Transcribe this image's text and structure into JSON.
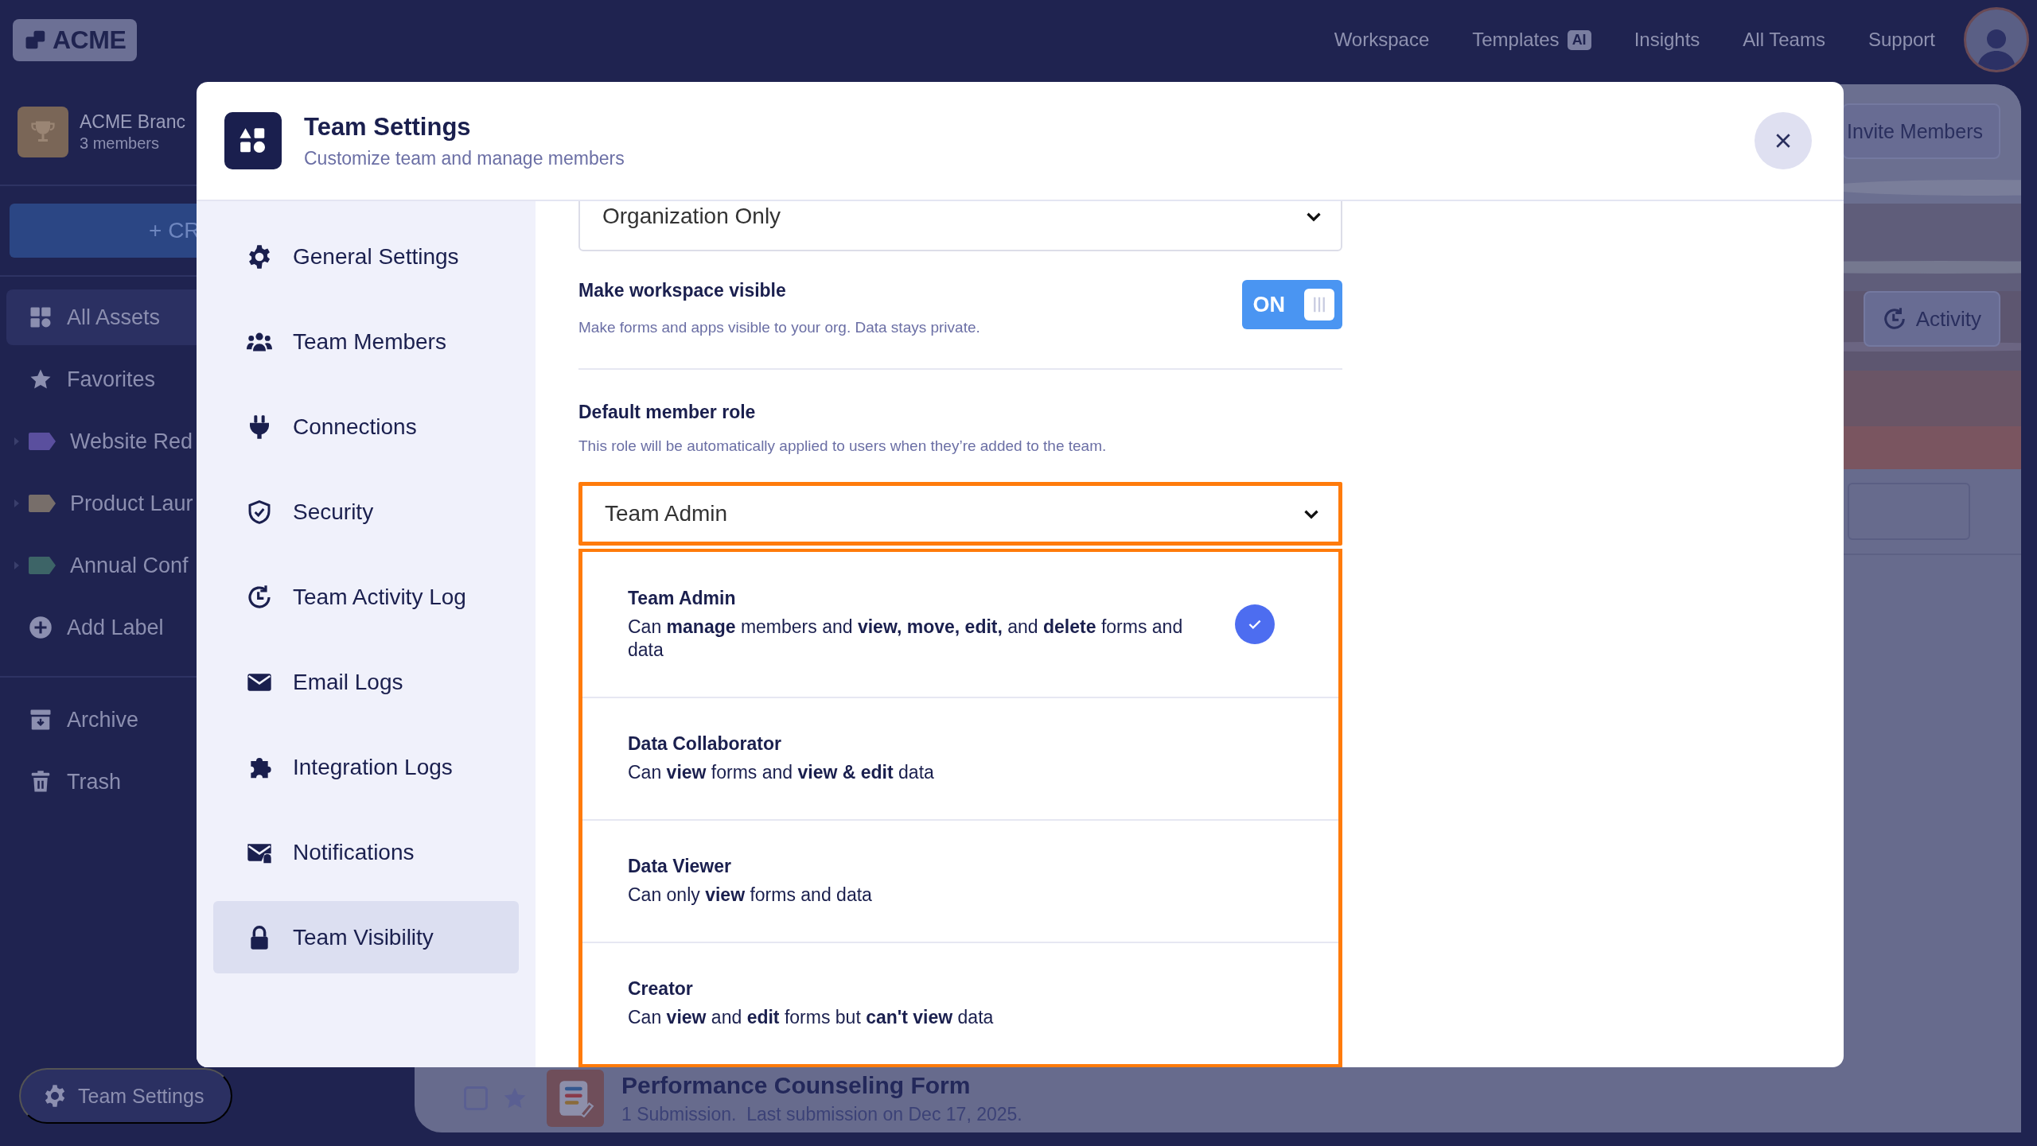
{
  "top_bar": {
    "logo": "ACME",
    "nav": [
      {
        "label": "Workspace"
      },
      {
        "label": "Templates",
        "badge": "AI"
      },
      {
        "label": "Insights"
      },
      {
        "label": "All Teams"
      },
      {
        "label": "Support"
      }
    ]
  },
  "sidebar": {
    "team": {
      "name": "ACME Branc",
      "members": "3 members"
    },
    "create_button": "+ CR",
    "items": [
      {
        "kind": "assets",
        "label": "All Assets",
        "selected": true
      },
      {
        "kind": "favorites",
        "label": "Favorites",
        "selected": false
      },
      {
        "kind": "label",
        "label": "Website Red",
        "color": "#5a4f9e",
        "selected": false
      },
      {
        "kind": "label",
        "label": "Product Laur",
        "color": "#776e6a",
        "selected": false
      },
      {
        "kind": "label",
        "label": "Annual Conf",
        "color": "#3d6467",
        "selected": false
      },
      {
        "kind": "add",
        "label": "Add Label",
        "selected": false
      }
    ],
    "bottom_items": [
      {
        "kind": "archive",
        "label": "Archive"
      },
      {
        "kind": "trash",
        "label": "Trash"
      }
    ],
    "settings_button": "Team Settings"
  },
  "workspace": {
    "invite_button": "Invite Members",
    "activity_button": "Activity",
    "form": {
      "checked": false,
      "title": "Performance Counseling Form",
      "subtitle": "1 Submission.  Last submission on Dec 17, 2025."
    }
  },
  "modal": {
    "title": "Team Settings",
    "subtitle": "Customize team and manage members",
    "menu": [
      {
        "kind": "gear",
        "label": "General Settings",
        "selected": false
      },
      {
        "kind": "people",
        "label": "Team Members",
        "selected": false
      },
      {
        "kind": "plug",
        "label": "Connections",
        "selected": false
      },
      {
        "kind": "shield",
        "label": "Security",
        "selected": false
      },
      {
        "kind": "clock",
        "label": "Team Activity Log",
        "selected": false
      },
      {
        "kind": "mail",
        "label": "Email Logs",
        "selected": false
      },
      {
        "kind": "puzzle",
        "label": "Integration Logs",
        "selected": false
      },
      {
        "kind": "bellmail",
        "label": "Notifications",
        "selected": false
      },
      {
        "kind": "lock",
        "label": "Team Visibility",
        "selected": true
      }
    ],
    "visibility_select": "Organization Only",
    "workspace_visible": {
      "title": "Make workspace visible",
      "description": "Make forms and apps visible to your org. Data stays private.",
      "on": true,
      "state_label": "ON"
    },
    "default_role": {
      "title": "Default member role",
      "description": "This role will be automatically applied to users when they’re added to the team.",
      "value": "Team Admin",
      "options": [
        {
          "name": "Team Admin",
          "description": "Can **manage** members and **view, move, edit,** and **delete** forms and data",
          "selected": true
        },
        {
          "name": "Data Collaborator",
          "description": "Can **view** forms and **view & edit** data",
          "selected": false
        },
        {
          "name": "Data Viewer",
          "description": "Can only **view** forms and data",
          "selected": false
        },
        {
          "name": "Creator",
          "description": "Can **view** and **edit** forms but **can't view** data",
          "selected": false
        }
      ]
    }
  }
}
